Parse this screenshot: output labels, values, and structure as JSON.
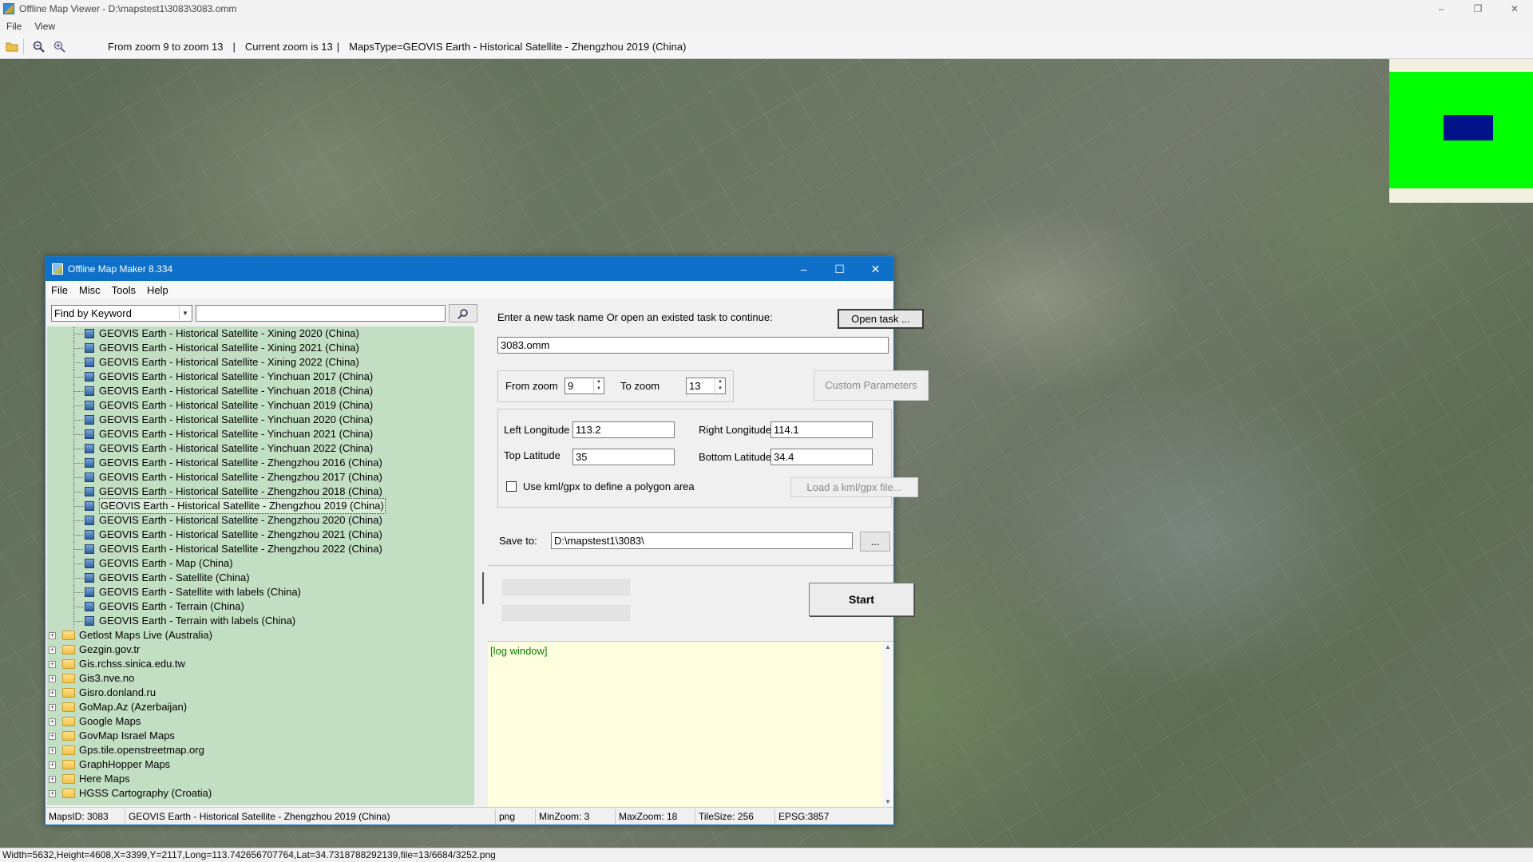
{
  "app": {
    "title": "Offline Map Viewer - D:\\mapstest1\\3083\\3083.omm",
    "menu": [
      "File",
      "View"
    ],
    "toolbar": {
      "zoom_range": "From zoom 9 to zoom 13",
      "current_zoom": "Current zoom is 13",
      "maps_type": "MapsType=GEOVIS Earth - Historical Satellite - Zhengzhou 2019 (China)"
    },
    "status": "Width=5632,Height=4608,X=3399,Y=2117,Long=113.742656707764,Lat=34.7318788292139,file=13/6684/3252.png",
    "icons": [
      "folder-open-icon",
      "zoom-out-icon",
      "zoom-in-icon"
    ]
  },
  "dialog": {
    "title": "Offline Map Maker 8.334",
    "menu": [
      "File",
      "Misc",
      "Tools",
      "Help"
    ],
    "search": {
      "mode": "Find by Keyword",
      "query": ""
    },
    "tree": {
      "children": [
        "GEOVIS Earth - Historical Satellite - Xining 2020 (China)",
        "GEOVIS Earth - Historical Satellite - Xining 2021 (China)",
        "GEOVIS Earth - Historical Satellite - Xining 2022 (China)",
        "GEOVIS Earth - Historical Satellite - Yinchuan 2017 (China)",
        "GEOVIS Earth - Historical Satellite - Yinchuan 2018 (China)",
        "GEOVIS Earth - Historical Satellite - Yinchuan 2019 (China)",
        "GEOVIS Earth - Historical Satellite - Yinchuan 2020 (China)",
        "GEOVIS Earth - Historical Satellite - Yinchuan 2021 (China)",
        "GEOVIS Earth - Historical Satellite - Yinchuan 2022 (China)",
        "GEOVIS Earth - Historical Satellite - Zhengzhou 2016 (China)",
        "GEOVIS Earth - Historical Satellite - Zhengzhou 2017 (China)",
        "GEOVIS Earth - Historical Satellite - Zhengzhou 2018 (China)",
        "GEOVIS Earth - Historical Satellite - Zhengzhou 2019 (China)",
        "GEOVIS Earth - Historical Satellite - Zhengzhou 2020 (China)",
        "GEOVIS Earth - Historical Satellite - Zhengzhou 2021 (China)",
        "GEOVIS Earth - Historical Satellite - Zhengzhou 2022 (China)",
        "GEOVIS Earth - Map (China)",
        "GEOVIS Earth - Satellite (China)",
        "GEOVIS Earth - Satellite with labels (China)",
        "GEOVIS Earth - Terrain (China)",
        "GEOVIS Earth - Terrain with labels (China)"
      ],
      "selected_index": 12,
      "folders": [
        "Getlost Maps Live (Australia)",
        "Gezgin.gov.tr",
        "Gis.rchss.sinica.edu.tw",
        "Gis3.nve.no",
        "Gisro.donland.ru",
        "GoMap.Az (Azerbaijan)",
        "Google Maps",
        "GovMap Israel Maps",
        "Gps.tile.openstreetmap.org",
        "GraphHopper Maps",
        "Here Maps",
        "HGSS Cartography (Croatia)"
      ]
    },
    "form": {
      "task_prompt": "Enter a new task name Or open an existed task to continue:",
      "open_task_label": "Open task ...",
      "task_name": "3083.omm",
      "from_zoom_label": "From zoom",
      "from_zoom": "9",
      "to_zoom_label": "To zoom",
      "to_zoom": "13",
      "custom_params_label": "Custom Parameters",
      "left_lon_label": "Left Longitude",
      "left_lon": "113.2",
      "right_lon_label": "Right Longitude",
      "right_lon": "114.1",
      "top_lat_label": "Top Latitude",
      "top_lat": "35",
      "bottom_lat_label": "Bottom Latitude",
      "bottom_lat": "34.4",
      "kml_label": "Use kml/gpx to define a polygon area",
      "load_kml_label": "Load a kml/gpx file...",
      "save_to_label": "Save to:",
      "save_to": "D:\\mapstest1\\3083\\",
      "browse_label": "...",
      "start_label": "Start",
      "log_text": "[log window]"
    },
    "status": {
      "maps_id": "MapsID: 3083",
      "map_name": "GEOVIS Earth - Historical Satellite - Zhengzhou 2019 (China)",
      "format": "png",
      "min_zoom": "MinZoom: 3",
      "max_zoom": "MaxZoom: 18",
      "tile_size": "TileSize: 256",
      "epsg": "EPSG:3857"
    }
  }
}
